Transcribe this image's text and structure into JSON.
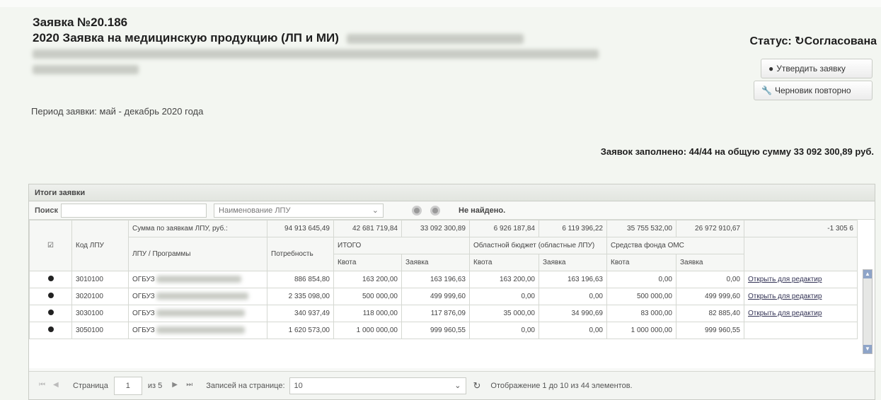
{
  "header": {
    "number": "Заявка №20.186",
    "title": "2020 Заявка на медицинскую продукцию (ЛП и МИ)",
    "period": "Период заявки: май - декабрь 2020 года",
    "status": "Статус: ↻Согласована"
  },
  "buttons": {
    "approve": "Утвердить заявку",
    "draft": "Черновик повторно"
  },
  "summary": "Заявок заполнено: 44/44 на общую сумму 33 092 300,89 руб.",
  "panel": {
    "title": "Итоги заявки",
    "search_label": "Поиск",
    "search_value": "",
    "filter_select": "Наименование ЛПУ",
    "not_found": "Не найдено."
  },
  "table": {
    "sum_label": "Сумма по заявкам ЛПУ, руб.:",
    "sums": [
      "94 913 645,49",
      "42 681 719,84",
      "33 092 300,89",
      "6 926 187,84",
      "6 119 396,22",
      "35 755 532,00",
      "26 972 910,67",
      "-1 305 6"
    ],
    "col_code": "Код ЛПУ",
    "col_lpu": "ЛПУ / Программы",
    "col_need": "Потребность",
    "group_total": "ИТОГО",
    "group_regional": "Областной бюджет (областные ЛПУ)",
    "group_oms": "Средства фонда ОМС",
    "sub_quota": "Квота",
    "sub_request": "Заявка",
    "rows": [
      {
        "code": "3010100",
        "lpu": "ОГБУЗ",
        "need": "886 854,80",
        "q1": "163 200,00",
        "r1": "163 196,63",
        "q2": "163 200,00",
        "r2": "163 196,63",
        "q3": "0,00",
        "r3": "0,00",
        "action": "Открыть для редактир"
      },
      {
        "code": "3020100",
        "lpu": "ОГБУЗ",
        "need": "2 335 098,00",
        "q1": "500 000,00",
        "r1": "499 999,60",
        "q2": "0,00",
        "r2": "0,00",
        "q3": "500 000,00",
        "r3": "499 999,60",
        "action": "Открыть для редактир"
      },
      {
        "code": "3030100",
        "lpu": "ОГБУЗ",
        "need": "340 937,49",
        "q1": "118 000,00",
        "r1": "117 876,09",
        "q2": "35 000,00",
        "r2": "34 990,69",
        "q3": "83 000,00",
        "r3": "82 885,40",
        "action": "Открыть для редактир"
      },
      {
        "code": "3050100",
        "lpu": "ОГБУЗ",
        "need": "1 620 573,00",
        "q1": "1 000 000,00",
        "r1": "999 960,55",
        "q2": "0,00",
        "r2": "0,00",
        "q3": "1 000 000,00",
        "r3": "999 960,55",
        "action": ""
      }
    ]
  },
  "pager": {
    "page_label": "Страница",
    "page_value": "1",
    "of_label": "из 5",
    "per_page_label": "Записей на странице:",
    "per_page_value": "10",
    "display_info": "Отображение 1 до 10 из 44 элементов."
  }
}
